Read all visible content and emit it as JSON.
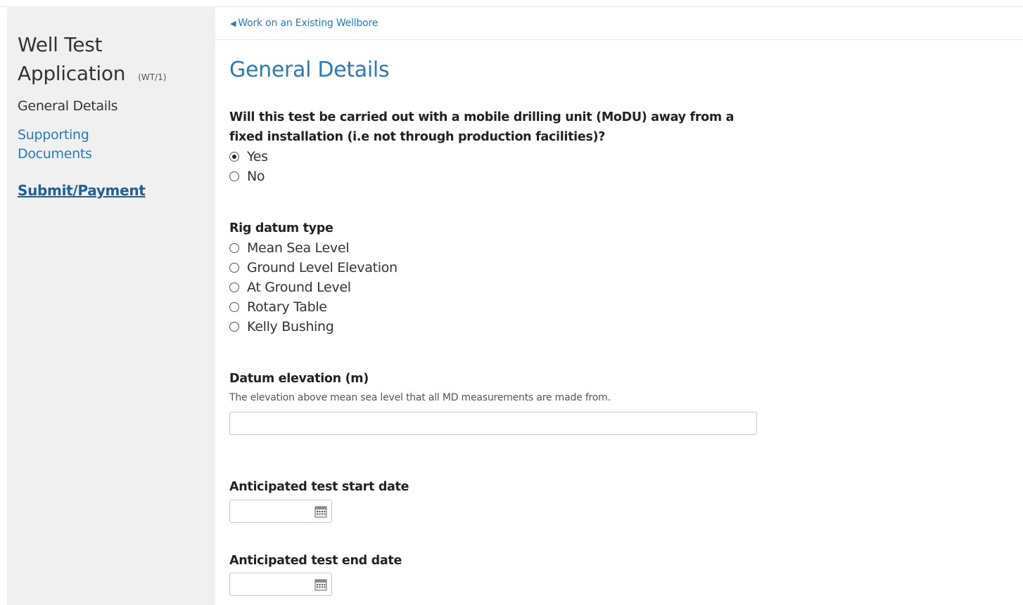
{
  "sidebar": {
    "title_line1": "Well Test",
    "title_line2": "Application",
    "title_code": "(WT/1)",
    "current_section": "General Details",
    "supporting_documents": "Supporting Documents",
    "submit_payment": "Submit/Payment"
  },
  "back_link": "Work on an Existing Wellbore",
  "page_title": "General Details",
  "modu_question": {
    "label": "Will this test be carried out with a mobile drilling unit (MoDU) away from a fixed installation (i.e not through production facilities)?",
    "options": [
      "Yes",
      "No"
    ],
    "selected": "Yes"
  },
  "rig_datum": {
    "label": "Rig datum type",
    "options": [
      "Mean Sea Level",
      "Ground Level Elevation",
      "At Ground Level",
      "Rotary Table",
      "Kelly Bushing"
    ],
    "selected": null
  },
  "datum_elevation": {
    "label": "Datum elevation (m)",
    "hint": "The elevation above mean sea level that all MD measurements are made from.",
    "value": ""
  },
  "start_date": {
    "label": "Anticipated test start date",
    "value": "",
    "icon": "calendar-icon"
  },
  "end_date": {
    "label": "Anticipated test end date",
    "value": "",
    "icon": "calendar-icon"
  },
  "colors": {
    "link": "#2a7ab5",
    "sidebar_bg": "#f0f0f0",
    "submit": "#1e5f94"
  }
}
